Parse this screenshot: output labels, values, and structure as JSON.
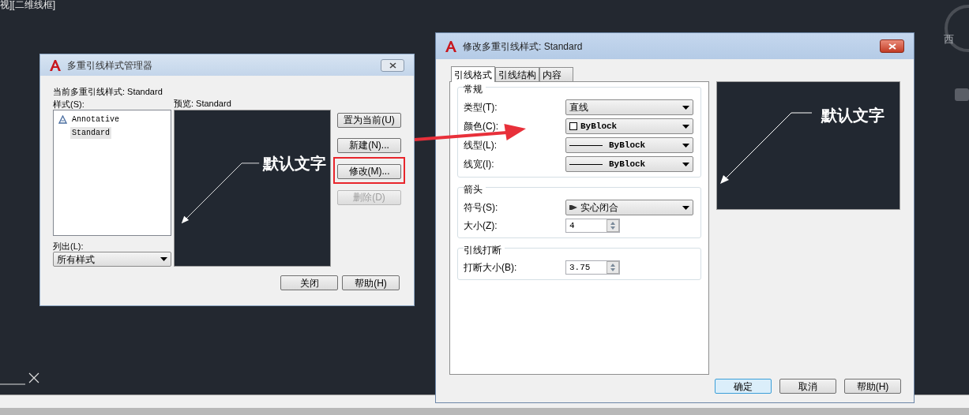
{
  "viewport_label": "视][二维线框]",
  "compass": {
    "label": "西"
  },
  "manager_dialog": {
    "title": "多重引线样式管理器",
    "current_style": "当前多重引线样式: Standard",
    "styles_label": "样式(S):",
    "styles": [
      {
        "name": "Annotative",
        "annotative": true,
        "selected": false
      },
      {
        "name": "Standard",
        "annotative": false,
        "selected": true
      }
    ],
    "preview_label": "预览: Standard",
    "preview_text": "默认文字",
    "list_label": "列出(L):",
    "list_value": "所有样式",
    "side_buttons": [
      {
        "label": "置为当前(U)",
        "disabled": false,
        "highlighted": false
      },
      {
        "label": "新建(N)...",
        "disabled": false,
        "highlighted": false
      },
      {
        "label": "修改(M)...",
        "disabled": false,
        "highlighted": true
      },
      {
        "label": "删除(D)",
        "disabled": true,
        "highlighted": false
      }
    ],
    "bottom_buttons": [
      "关闭",
      "帮助(H)"
    ]
  },
  "modify_dialog": {
    "title": "修改多重引线样式: Standard",
    "tabs": [
      {
        "label": "引线格式",
        "selected": true
      },
      {
        "label": "引线结构",
        "selected": false
      },
      {
        "label": "内容",
        "selected": false
      }
    ],
    "groups": [
      {
        "title": "常规",
        "rows": [
          {
            "kind": "dropdown",
            "label": "类型(T):",
            "value": "直线"
          },
          {
            "kind": "color",
            "label": "颜色(C):",
            "value": "ByBlock"
          },
          {
            "kind": "line",
            "label": "线型(L):",
            "value": "ByBlock"
          },
          {
            "kind": "line",
            "label": "线宽(I):",
            "value": "ByBlock"
          }
        ]
      },
      {
        "title": "箭头",
        "rows": [
          {
            "kind": "arrowhead",
            "label": "符号(S):",
            "value": "实心闭合"
          },
          {
            "kind": "spinner",
            "label": "大小(Z):",
            "value": "4"
          }
        ]
      },
      {
        "title": "引线打断",
        "rows": [
          {
            "kind": "spinner",
            "label": "打断大小(B):",
            "value": "3.75"
          }
        ]
      }
    ],
    "preview_text": "默认文字",
    "buttons": [
      {
        "label": "确定",
        "default": true
      },
      {
        "label": "取消",
        "default": false
      },
      {
        "label": "帮助(H)",
        "default": false
      }
    ]
  }
}
